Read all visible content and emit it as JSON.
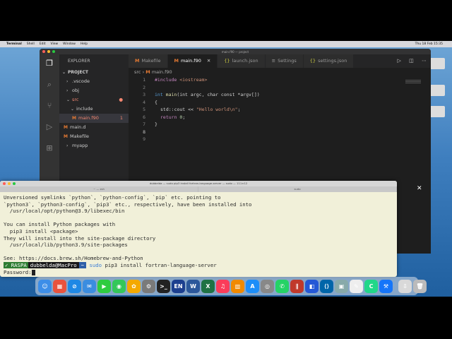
{
  "menubar": {
    "apple": "",
    "items": [
      "Terminal",
      "Shell",
      "Edit",
      "View",
      "Window",
      "Help"
    ],
    "clock": "Thu 18 Feb 15:35"
  },
  "vscode": {
    "title": "main.f90 — project",
    "sidebar": {
      "header": "EXPLORER",
      "project": "PROJECT",
      "items": [
        {
          "label": ".vscode",
          "chev": "›"
        },
        {
          "label": "obj",
          "chev": "›"
        },
        {
          "label": "src",
          "chev": "⌄"
        },
        {
          "label": "include",
          "chev": "⌄"
        },
        {
          "label": "main.f90",
          "icon": "M",
          "badge": "1"
        },
        {
          "label": "main.d",
          "icon": "M"
        },
        {
          "label": "Makefile",
          "icon": "M"
        },
        {
          "label": "myapp",
          "chev": "›"
        }
      ]
    },
    "tabs": [
      {
        "label": "Makefile",
        "icon": "M"
      },
      {
        "label": "main.f90",
        "icon": "M",
        "close": "✕"
      },
      {
        "label": "launch.json",
        "icon": "{}"
      },
      {
        "label": "Settings",
        "icon": "≡"
      },
      {
        "label": "settings.json",
        "icon": "{}"
      }
    ],
    "breadcrumb": {
      "folder": "src",
      "sep": "›",
      "icon": "M",
      "file": "main.f90"
    },
    "code": {
      "lines": [
        "1",
        "2",
        "3",
        "4",
        "5",
        "6",
        "7",
        "8",
        "9"
      ],
      "l1_pp": "#include ",
      "l1_lib": "<iostream>",
      "l3_ty": "int ",
      "l3_fn": "main",
      "l3_rest": "(int argc, char const *argv[])",
      "l4": "{",
      "l5_a": "std::cout << ",
      "l5_str": "\"Hello world\\n\"",
      "l5_end": ";",
      "l6_kw": "return ",
      "l6_num": "0",
      "l6_end": ";",
      "l7": "}"
    },
    "statusbar_fragment": "0"
  },
  "terminal": {
    "title": "dubbelda — sudo pip3 install fortran-language-server — sudo — 111×12",
    "tabs": [
      "~ — zsh",
      "sudo"
    ],
    "lines": [
      "Unversioned symlinks `python`, `python-config`, `pip` etc. pointing to",
      "`python3`, `python3-config`, `pip3` etc., respectively, have been installed into",
      "  /usr/local/opt/python@3.9/libexec/bin",
      "",
      "You can install Python packages with",
      "  pip3 install <package>",
      "They will install into the site-package directory",
      "  /usr/local/lib/python3.9/site-packages",
      "",
      "See: https://docs.brew.sh/Homebrew-and-Python"
    ],
    "prompt": {
      "env": "✓ RASPA",
      "user": "dubbelda@MacPro",
      "dir": "~",
      "sudo": "sudo",
      "command": " pip3 install fortran-language-server"
    },
    "password": "Password:"
  },
  "dock": {
    "items": [
      {
        "name": "finder",
        "color": "#3d8ee8",
        "glyph": "☺"
      },
      {
        "name": "launchpad",
        "color": "#e9533e",
        "glyph": "▦"
      },
      {
        "name": "safari",
        "color": "#1e88e5",
        "glyph": "⊘"
      },
      {
        "name": "mail",
        "color": "#3b8de0",
        "glyph": "✉"
      },
      {
        "name": "facetime",
        "color": "#2ecc40",
        "glyph": "▶"
      },
      {
        "name": "messages",
        "color": "#34c759",
        "glyph": "◉"
      },
      {
        "name": "photos",
        "color": "#f4a900",
        "glyph": "✿"
      },
      {
        "name": "system-prefs",
        "color": "#7a7a7a",
        "glyph": "⚙"
      },
      {
        "name": "terminal",
        "color": "#222",
        "glyph": ">_"
      },
      {
        "name": "english",
        "color": "#1c3f8f",
        "glyph": "EN"
      },
      {
        "name": "word",
        "color": "#2b579a",
        "glyph": "W"
      },
      {
        "name": "excel",
        "color": "#1f7244",
        "glyph": "X"
      },
      {
        "name": "music",
        "color": "#fa3c5a",
        "glyph": "♫"
      },
      {
        "name": "books",
        "color": "#f08a00",
        "glyph": "▥"
      },
      {
        "name": "app-store",
        "color": "#1c8ef9",
        "glyph": "A"
      },
      {
        "name": "chrome",
        "color": "#888",
        "glyph": "◎"
      },
      {
        "name": "whatsapp",
        "color": "#25d366",
        "glyph": "✆"
      },
      {
        "name": "parallels",
        "color": "#c0392b",
        "glyph": "∥"
      },
      {
        "name": "xcode-instruments",
        "color": "#2458d6",
        "glyph": "◧"
      },
      {
        "name": "vscode",
        "color": "#0065a9",
        "glyph": "⟨⟩"
      },
      {
        "name": "preview",
        "color": "#8aa",
        "glyph": "▣"
      },
      {
        "name": "textedit",
        "color": "#eee",
        "glyph": "✎"
      },
      {
        "name": "clion",
        "color": "#21d789",
        "glyph": "C"
      },
      {
        "name": "xcode",
        "color": "#1575f9",
        "glyph": "⚒"
      },
      {
        "name": "downloads",
        "color": "#d9d9d9",
        "glyph": "⇩"
      },
      {
        "name": "trash",
        "color": "#bbb",
        "glyph": "🗑"
      }
    ]
  }
}
